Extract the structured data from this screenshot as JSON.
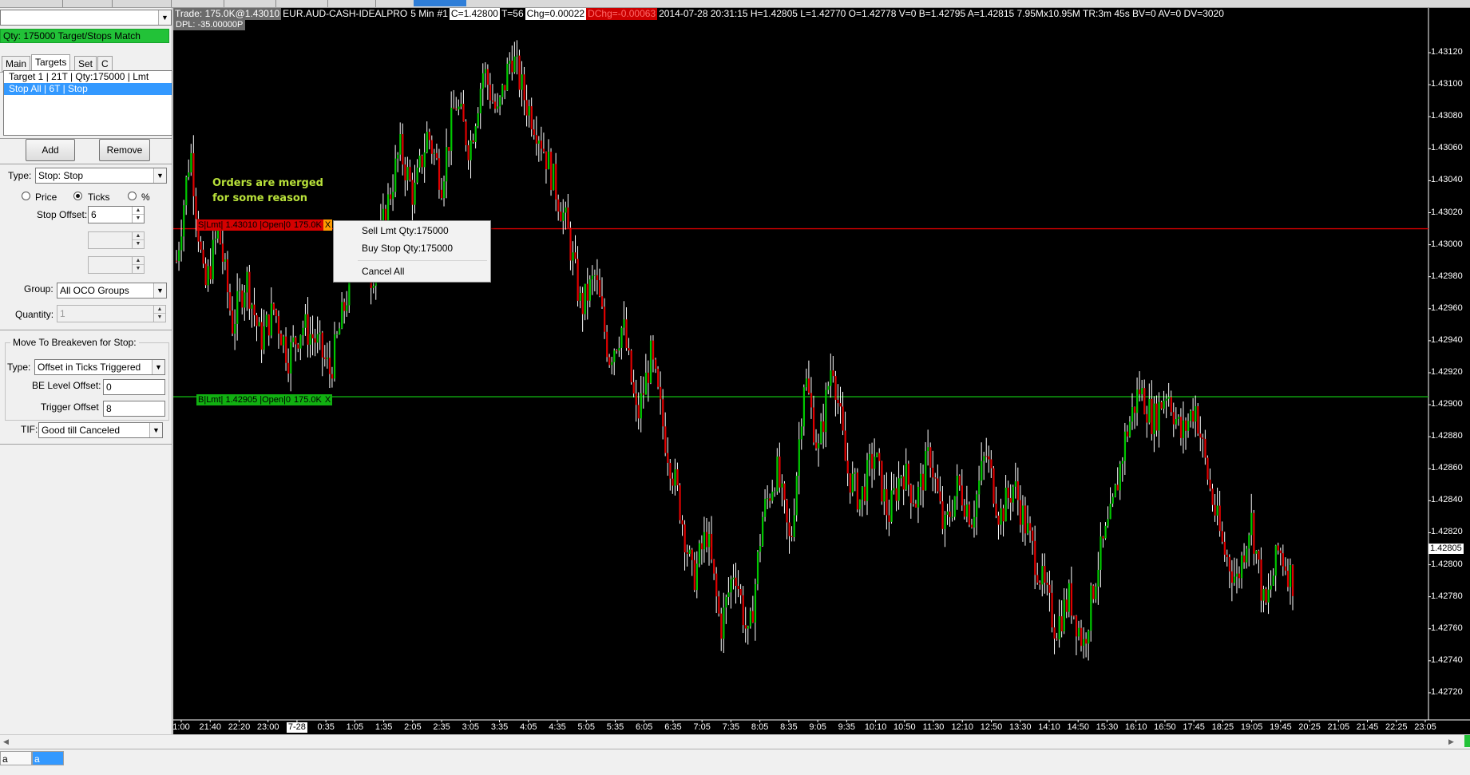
{
  "left_panel": {
    "account_combo": "",
    "status_text": "Qty: 175000 Target/Stops Match",
    "tabs": [
      {
        "label": "Main",
        "active": false
      },
      {
        "label": "Targets",
        "active": true
      },
      {
        "label": "Set",
        "active": false
      },
      {
        "label": "C",
        "active": false
      }
    ],
    "targets_list": [
      {
        "label": "Target 1 | 21T | Qty:175000 | Lmt",
        "selected": false
      },
      {
        "label": "Stop All | 6T | Stop",
        "selected": true
      }
    ],
    "add_label": "Add",
    "remove_label": "Remove",
    "type_label": "Type:",
    "type_value": "Stop: Stop",
    "radio_price": "Price",
    "radio_ticks": "Ticks",
    "radio_percent": "%",
    "radio_selected": "Ticks",
    "stop_offset_label": "Stop Offset:",
    "stop_offset_value": "6",
    "group_label": "Group:",
    "group_value": "All OCO Groups",
    "quantity_label": "Quantity:",
    "quantity_value": "1",
    "breakeven": {
      "legend": "Move To Breakeven for Stop:",
      "type_label": "Type:",
      "type_value": "Offset in Ticks Triggered",
      "be_level_label": "BE Level Offset:",
      "be_level_value": "0",
      "trigger_label": "Trigger Offset",
      "trigger_value": "8"
    },
    "tif_label": "TIF:",
    "tif_value": "Good till Canceled"
  },
  "chart": {
    "infobar": {
      "trade": "Trade: 175.0K@1.43010",
      "symbol": "EUR.AUD-CASH-IDEALPRO",
      "interval": "5 Min",
      "index": "#1",
      "close": "C=1.42800",
      "ticks": "T=56",
      "chg": "Chg=0.00022",
      "dchg": "DChg=-0.00063",
      "stats": "2014-07-28 20:31:15 H=1.42805 L=1.42770 O=1.42778 V=0 B=1.42795 A=1.42815 7.95Mx10.95M TR:3m 45s BV=0 AV=0 DV=3020"
    },
    "dpl": "DPL: -35.00000P",
    "annotation": "Orders are merged for some reason",
    "sell_order": [
      "S|Lmt| 1.43010 |Open|0",
      "175.0K",
      "X"
    ],
    "buy_order": [
      "B|Lmt| 1.42905 |Open|0",
      "175.0K",
      "X"
    ],
    "context_menu": [
      "Sell Lmt Qty:175000",
      "Buy Stop Qty:175000",
      "Cancel All"
    ],
    "current_price": "1.42805",
    "colors": {
      "up": "#00c800",
      "down": "#e00000",
      "wick": "#ffffff",
      "sell_line": "#d40000",
      "buy_line": "#11b011"
    }
  },
  "chart_data": {
    "type": "candlestick",
    "title": "",
    "y_axis": {
      "min": 1.4271,
      "max": 1.43125,
      "ticks": [
        "1.43120",
        "1.43100",
        "1.43080",
        "1.43060",
        "1.43040",
        "1.43020",
        "1.43000",
        "1.42980",
        "1.42960",
        "1.42940",
        "1.42920",
        "1.42900",
        "1.42880",
        "1.42860",
        "1.42840",
        "1.42820",
        "1.42800",
        "1.42780",
        "1.42760",
        "1.42740",
        "1.42720"
      ]
    },
    "x_axis": {
      "ticks": [
        "1:00",
        "21:40",
        "22:20",
        "23:00",
        "7-28",
        "0:35",
        "1:05",
        "1:35",
        "2:05",
        "2:35",
        "3:05",
        "3:35",
        "4:05",
        "4:35",
        "5:05",
        "5:35",
        "6:05",
        "6:35",
        "7:05",
        "7:35",
        "8:05",
        "8:35",
        "9:05",
        "9:35",
        "10:10",
        "10:50",
        "11:30",
        "12:10",
        "12:50",
        "13:30",
        "14:10",
        "14:50",
        "15:30",
        "16:10",
        "16:50",
        "17:45",
        "18:25",
        "19:05",
        "19:45",
        "20:25",
        "21:05",
        "21:45",
        "22:25",
        "23:05"
      ],
      "highlighted": "7-28"
    },
    "horizontal_lines": [
      {
        "label": "Sell Limit",
        "price": 1.4301
      },
      {
        "label": "Buy Limit",
        "price": 1.42905
      }
    ],
    "anchors": [
      1.4299,
      1.4306,
      1.4297,
      1.4301,
      1.4295,
      1.4298,
      1.4294,
      1.4296,
      1.4293,
      1.4295,
      1.4294,
      1.4292,
      1.4296,
      1.43,
      1.4298,
      1.4302,
      1.4306,
      1.4303,
      1.4307,
      1.4304,
      1.4309,
      1.4306,
      1.4311,
      1.4308,
      1.4312,
      1.4309,
      1.4307,
      1.4304,
      1.4301,
      1.4296,
      1.4298,
      1.4293,
      1.4295,
      1.4289,
      1.4293,
      1.4288,
      1.4284,
      1.4279,
      1.4282,
      1.4276,
      1.428,
      1.4275,
      1.4283,
      1.4286,
      1.4281,
      1.4292,
      1.4287,
      1.4293,
      1.4286,
      1.4284,
      1.4287,
      1.4283,
      1.4286,
      1.4284,
      1.4287,
      1.4282,
      1.4285,
      1.4283,
      1.4287,
      1.4283,
      1.4285,
      1.4282,
      1.4279,
      1.4276,
      1.4278,
      1.4275,
      1.428,
      1.4283,
      1.4288,
      1.4291,
      1.4289,
      1.4291,
      1.4288,
      1.429,
      1.4285,
      1.4281,
      1.4279,
      1.4283,
      1.4277,
      1.4281,
      1.4279
    ]
  }
}
